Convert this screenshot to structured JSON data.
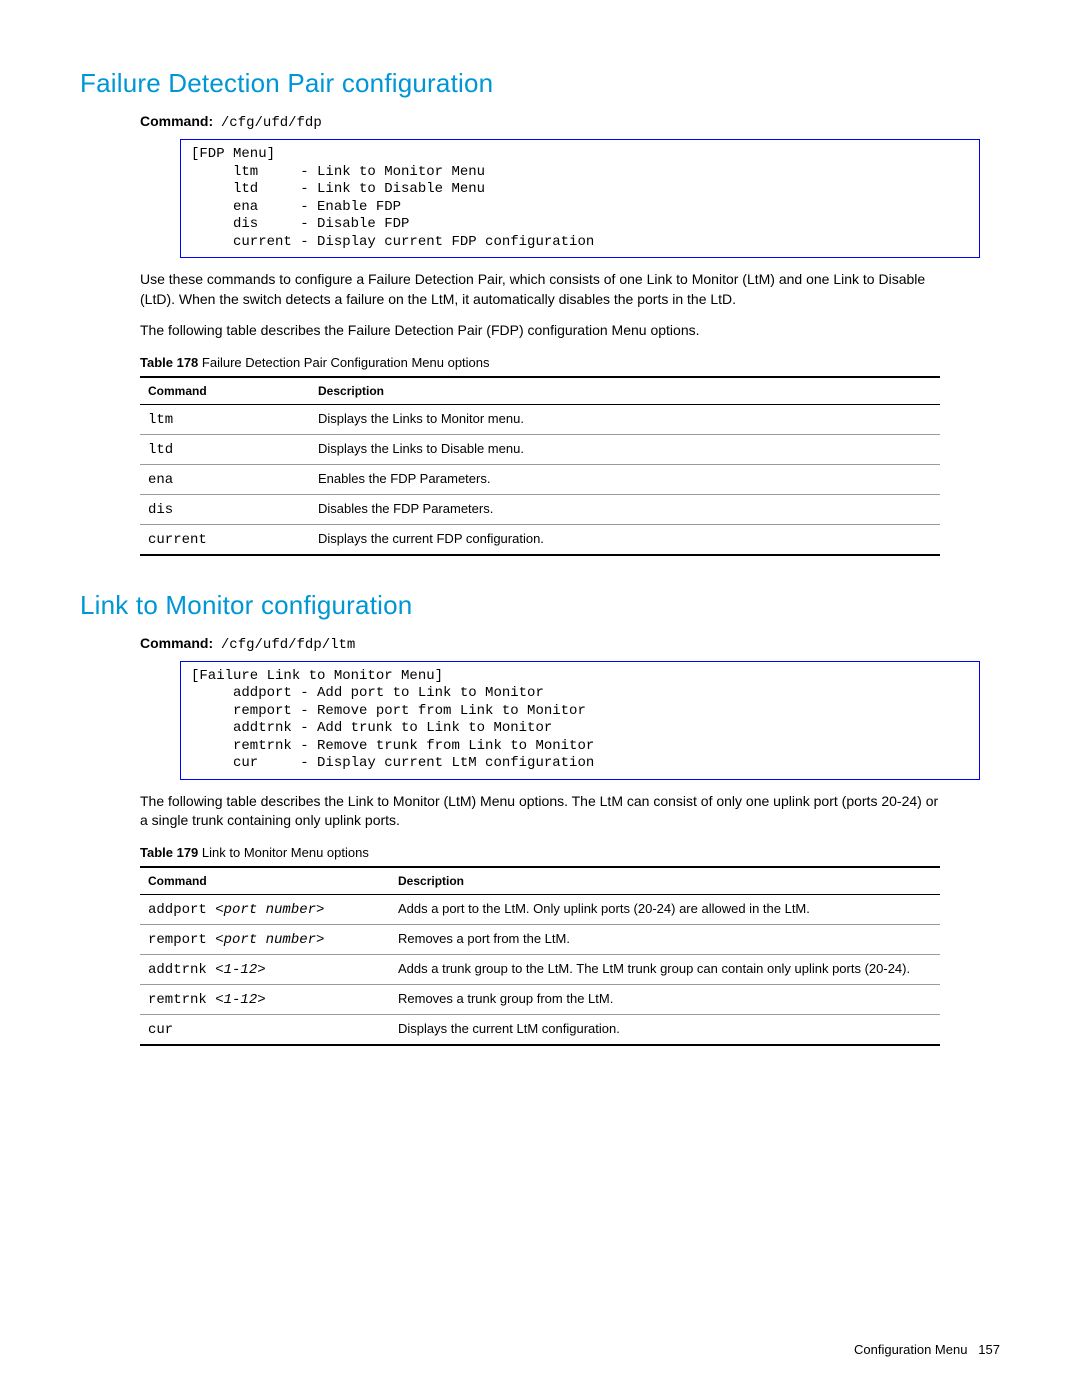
{
  "sections": [
    {
      "title": "Failure Detection Pair configuration",
      "cmd_label": "Command:",
      "cmd_value": "/cfg/ufd/fdp",
      "codebox": "[FDP Menu]\n     ltm     - Link to Monitor Menu\n     ltd     - Link to Disable Menu\n     ena     - Enable FDP\n     dis     - Disable FDP\n     current - Display current FDP configuration",
      "paragraphs": [
        "Use these commands to configure a Failure Detection Pair, which consists of one Link to Monitor (LtM) and one Link to Disable (LtD). When the switch detects a failure on the LtM, it automatically disables the ports in the LtD.",
        "The following table describes the Failure Detection Pair (FDP) configuration Menu options."
      ],
      "table_caption_num": "Table 178",
      "table_caption_text": " Failure Detection Pair Configuration Menu options",
      "col_cmd_class": "col-cmd",
      "col1": "Command",
      "col2": "Description",
      "rows": [
        {
          "cmd": "ltm",
          "arg": "",
          "desc": "Displays the Links to Monitor menu."
        },
        {
          "cmd": "ltd",
          "arg": "",
          "desc": "Displays the Links to Disable menu."
        },
        {
          "cmd": "ena",
          "arg": "",
          "desc": "Enables the FDP Parameters."
        },
        {
          "cmd": "dis",
          "arg": "",
          "desc": "Disables the FDP Parameters."
        },
        {
          "cmd": "current",
          "arg": "",
          "desc": "Displays the current FDP configuration."
        }
      ]
    },
    {
      "title": "Link to Monitor configuration",
      "cmd_label": "Command:",
      "cmd_value": "/cfg/ufd/fdp/ltm",
      "codebox": "[Failure Link to Monitor Menu]\n     addport - Add port to Link to Monitor\n     remport - Remove port from Link to Monitor\n     addtrnk - Add trunk to Link to Monitor\n     remtrnk - Remove trunk from Link to Monitor\n     cur     - Display current LtM configuration",
      "paragraphs": [
        "The following table describes the Link to Monitor (LtM) Menu options. The LtM can consist of only one uplink port (ports 20-24) or a single trunk containing only uplink ports."
      ],
      "table_caption_num": "Table 179",
      "table_caption_text": " Link to Monitor Menu options",
      "col_cmd_class": "col-cmd-wide",
      "col1": "Command",
      "col2": "Description",
      "rows": [
        {
          "cmd": "addport ",
          "arg": "<port number>",
          "desc": "Adds a port to the LtM. Only uplink ports (20-24) are allowed in the LtM."
        },
        {
          "cmd": "remport ",
          "arg": "<port number>",
          "desc": "Removes a port from the LtM."
        },
        {
          "cmd": "addtrnk ",
          "arg": "<1-12>",
          "desc": "Adds a trunk group to the LtM. The LtM trunk group can contain only uplink ports (20-24)."
        },
        {
          "cmd": "remtrnk ",
          "arg": "<1-12>",
          "desc": "Removes a trunk group from the LtM."
        },
        {
          "cmd": "cur",
          "arg": "",
          "desc": "Displays the current LtM configuration."
        }
      ]
    }
  ],
  "footer": {
    "section_name": "Configuration Menu",
    "page_num": "157"
  }
}
